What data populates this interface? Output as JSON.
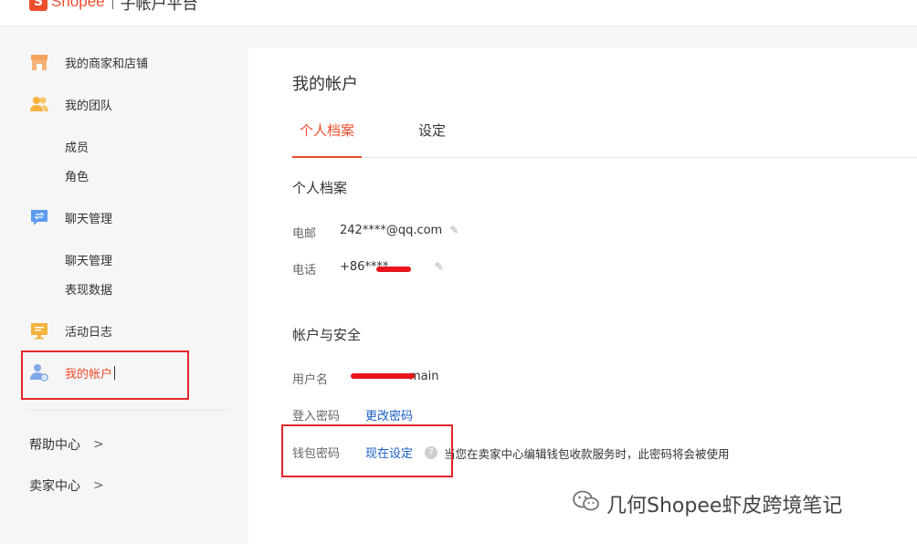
{
  "brand": {
    "icon_letter": "S",
    "name": "Shopee",
    "subtitle": "子帐户平台"
  },
  "sidebar": {
    "items": [
      {
        "label": "我的商家和店铺",
        "icon": "store-icon"
      },
      {
        "label": "我的团队",
        "icon": "team-icon"
      },
      {
        "label": "聊天管理",
        "icon": "chat-icon"
      },
      {
        "label": "活动日志",
        "icon": "log-icon"
      },
      {
        "label": "我的帐户",
        "icon": "account-icon"
      }
    ],
    "team_sub": [
      "成员",
      "角色"
    ],
    "chat_sub": [
      "聊天管理",
      "表现数据"
    ],
    "links": [
      {
        "label": "帮助中心",
        "chevron": ">"
      },
      {
        "label": "卖家中心",
        "chevron": ">"
      }
    ]
  },
  "main": {
    "title": "我的帐户",
    "tabs": [
      "个人档案",
      "设定"
    ],
    "profile": {
      "title": "个人档案",
      "email_label": "电邮",
      "email_value": "242****@qq.com",
      "phone_label": "电话",
      "phone_value": "+86****"
    },
    "security": {
      "title": "帐户与安全",
      "username_label": "用户名",
      "username_value": "main",
      "login_password_label": "登入密码",
      "login_password_action": "更改密码",
      "wallet_password_label": "钱包密码",
      "wallet_password_action": "现在设定",
      "wallet_hint": "当您在卖家中心编辑钱包收款服务时，此密码将会被使用"
    }
  },
  "watermark": {
    "text": "几何Shopee虾皮跨境笔记"
  },
  "colors": {
    "accent": "#ee4d2d",
    "link": "#1a5ec6",
    "annotation": "#e4262b"
  }
}
